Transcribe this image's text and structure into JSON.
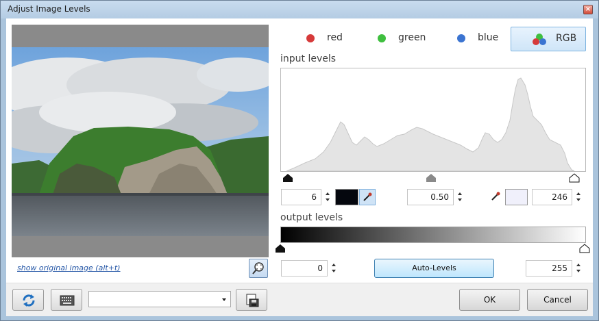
{
  "window": {
    "title": "Adjust Image Levels",
    "close_label": "×"
  },
  "preview": {
    "show_original_link": "show original image (alt+t)"
  },
  "channels": [
    {
      "label": "red",
      "color": "#d63a3a"
    },
    {
      "label": "green",
      "color": "#3fbf3f"
    },
    {
      "label": "blue",
      "color": "#3b74d1"
    },
    {
      "label": "RGB",
      "selected": true
    }
  ],
  "input_levels": {
    "label": "input levels",
    "black_point": "6",
    "gamma": "0.50",
    "white_point": "246",
    "black_swatch_color": "#05070e",
    "white_swatch_color": "#f0f0fb"
  },
  "output_levels": {
    "label": "output levels",
    "min": "0",
    "max": "255",
    "auto_levels_label": "Auto-Levels"
  },
  "footer": {
    "preset_value": "",
    "ok_label": "OK",
    "cancel_label": "Cancel"
  }
}
